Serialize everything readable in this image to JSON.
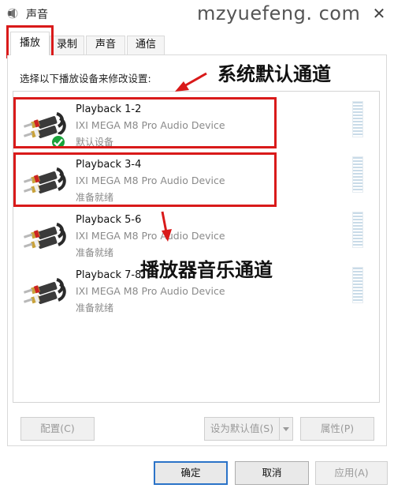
{
  "window": {
    "title": "声音",
    "close_glyph": "✕"
  },
  "watermark": "mzyuefeng. com",
  "tabs": [
    {
      "label": "播放",
      "active": true
    },
    {
      "label": "录制",
      "active": false
    },
    {
      "label": "声音",
      "active": false
    },
    {
      "label": "通信",
      "active": false
    }
  ],
  "instruction": "选择以下播放设备来修改设置:",
  "devices": [
    {
      "name": "Playback 1-2",
      "description": "IXI MEGA M8 Pro Audio Device",
      "status": "默认设备",
      "is_default": true,
      "icon": "rca-cable-icon"
    },
    {
      "name": "Playback 3-4",
      "description": "IXI MEGA M8 Pro Audio Device",
      "status": "准备就绪",
      "is_default": false,
      "icon": "rca-cable-icon"
    },
    {
      "name": "Playback 5-6",
      "description": "IXI MEGA M8 Pro Audio Device",
      "status": "准备就绪",
      "is_default": false,
      "icon": "rca-cable-icon"
    },
    {
      "name": "Playback 7-8",
      "description": "IXI MEGA M8 Pro Audio Device",
      "status": "准备就绪",
      "is_default": false,
      "icon": "rca-cable-icon"
    }
  ],
  "annotations": {
    "system_channel": "系统默认通道",
    "player_channel": "播放器音乐通道",
    "highlight_color": "#d91a1a"
  },
  "buttons": {
    "configure": "配置(C)",
    "set_default": "设为默认值(S)",
    "properties": "属性(P)",
    "ok": "确定",
    "cancel": "取消",
    "apply": "应用(A)"
  }
}
